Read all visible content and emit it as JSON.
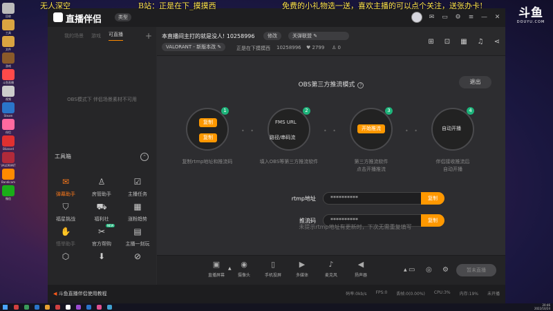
{
  "overlay": {
    "left_text": "无人深空",
    "mid_text": "B站：正是在下_摸摸西",
    "right_text": "免费的小礼物选一送，喜欢主播的可以点个关注，送张办卡!"
  },
  "douyu": {
    "big": "斗鱼",
    "small": "DOUYU.COM"
  },
  "desktop_icons": [
    {
      "label": "回收",
      "color": "#bbb"
    },
    {
      "label": "工具",
      "color": "#d9a441"
    },
    {
      "label": "文件",
      "color": "#d9a441"
    },
    {
      "label": "游戏",
      "color": "#8a5a2a"
    },
    {
      "label": "斗鱼直播",
      "color": "#ff4a4a"
    },
    {
      "label": "视频",
      "color": "#ccc"
    },
    {
      "label": "Steam",
      "color": "#2a74c9"
    },
    {
      "label": "伴侣",
      "color": "#ff6aa0"
    },
    {
      "label": "Blizzard",
      "color": "#e03030"
    },
    {
      "label": "VALORANT",
      "color": "#b02a3a"
    },
    {
      "label": "Bandicam",
      "color": "#ff8a00"
    },
    {
      "label": "微信",
      "color": "#1aad19"
    }
  ],
  "app": {
    "logo_text": "直播伴侣",
    "type_button": "类型",
    "tabs": [
      "我的场景",
      "游戏",
      "可直播"
    ],
    "obs_note": "OBS模式下 伴侣场景素材不可用",
    "toolbox_title": "工具箱",
    "tools": [
      {
        "label": "弹幕助手",
        "icon": "✉"
      },
      {
        "label": "房管助手",
        "icon": "♙"
      },
      {
        "label": "主播任务",
        "icon": "☑"
      },
      {
        "label": "福星挑战",
        "icon": "⛉"
      },
      {
        "label": "福利社",
        "icon": "⛟"
      },
      {
        "label": "涨粉趋势",
        "icon": "▦"
      },
      {
        "label": "悟举助手",
        "icon": "✋"
      },
      {
        "label": "官方帮购",
        "icon": "✂",
        "badge": "NEW"
      },
      {
        "label": "主播一刻玩",
        "icon": "▤"
      },
      {
        "label": "",
        "icon": "⬡"
      },
      {
        "label": "",
        "icon": "⬇"
      },
      {
        "label": "",
        "icon": "⊘"
      }
    ],
    "room": {
      "title": "本直播间主打的就是没人! 10258996",
      "edit_button": "修改",
      "league_button": "关弹联盟",
      "category": "VALORANT - 新版本改",
      "streamer": "正是在下摸摸西",
      "room_id": "10258996",
      "fans": "2799",
      "online": "0"
    },
    "mode_title": "OBS第三方推流模式",
    "exit_button": "退出",
    "steps": [
      {
        "num": "1",
        "btn1": "复制",
        "btn2": "复制",
        "desc": "复制rtmp地址和推流码"
      },
      {
        "num": "2",
        "line1": "FMS URL",
        "line2": "路径/串码流",
        "desc": "填入OBS等第三方推流软件"
      },
      {
        "num": "3",
        "btn": "开始推流",
        "desc": "第三方推流软件\n点击开播推流"
      },
      {
        "num": "4",
        "btn": "自动开播",
        "desc": "伴侣接收推流后\n自动开播"
      }
    ],
    "rtmp_label": "rtmp地址",
    "rtmp_value": "**********",
    "key_label": "推流码",
    "key_value": "**********",
    "copy_label": "复制",
    "hint": "未提示rtmp地址有更新时，下次无需重复填写",
    "bottom": [
      {
        "label": "直播屏幕",
        "icon": "▣"
      },
      {
        "label": "摄像头",
        "icon": "◉"
      },
      {
        "label": "手机投屏",
        "icon": "▯"
      },
      {
        "label": "多媒体",
        "icon": "▶"
      },
      {
        "label": "麦克风",
        "icon": "♪"
      },
      {
        "label": "扬声器",
        "icon": "◀"
      }
    ],
    "stop_button": "暂未直播",
    "status_left": "斗鱼直播伴侣使用教程",
    "status_right": [
      "码率:0kb/s",
      "FPS:0",
      "丢帧:0(0.00%)",
      "CPU:3%",
      "内存:19%",
      "未开播"
    ]
  },
  "taskbar": {
    "time": "20:46",
    "date": "2022/10/24"
  }
}
